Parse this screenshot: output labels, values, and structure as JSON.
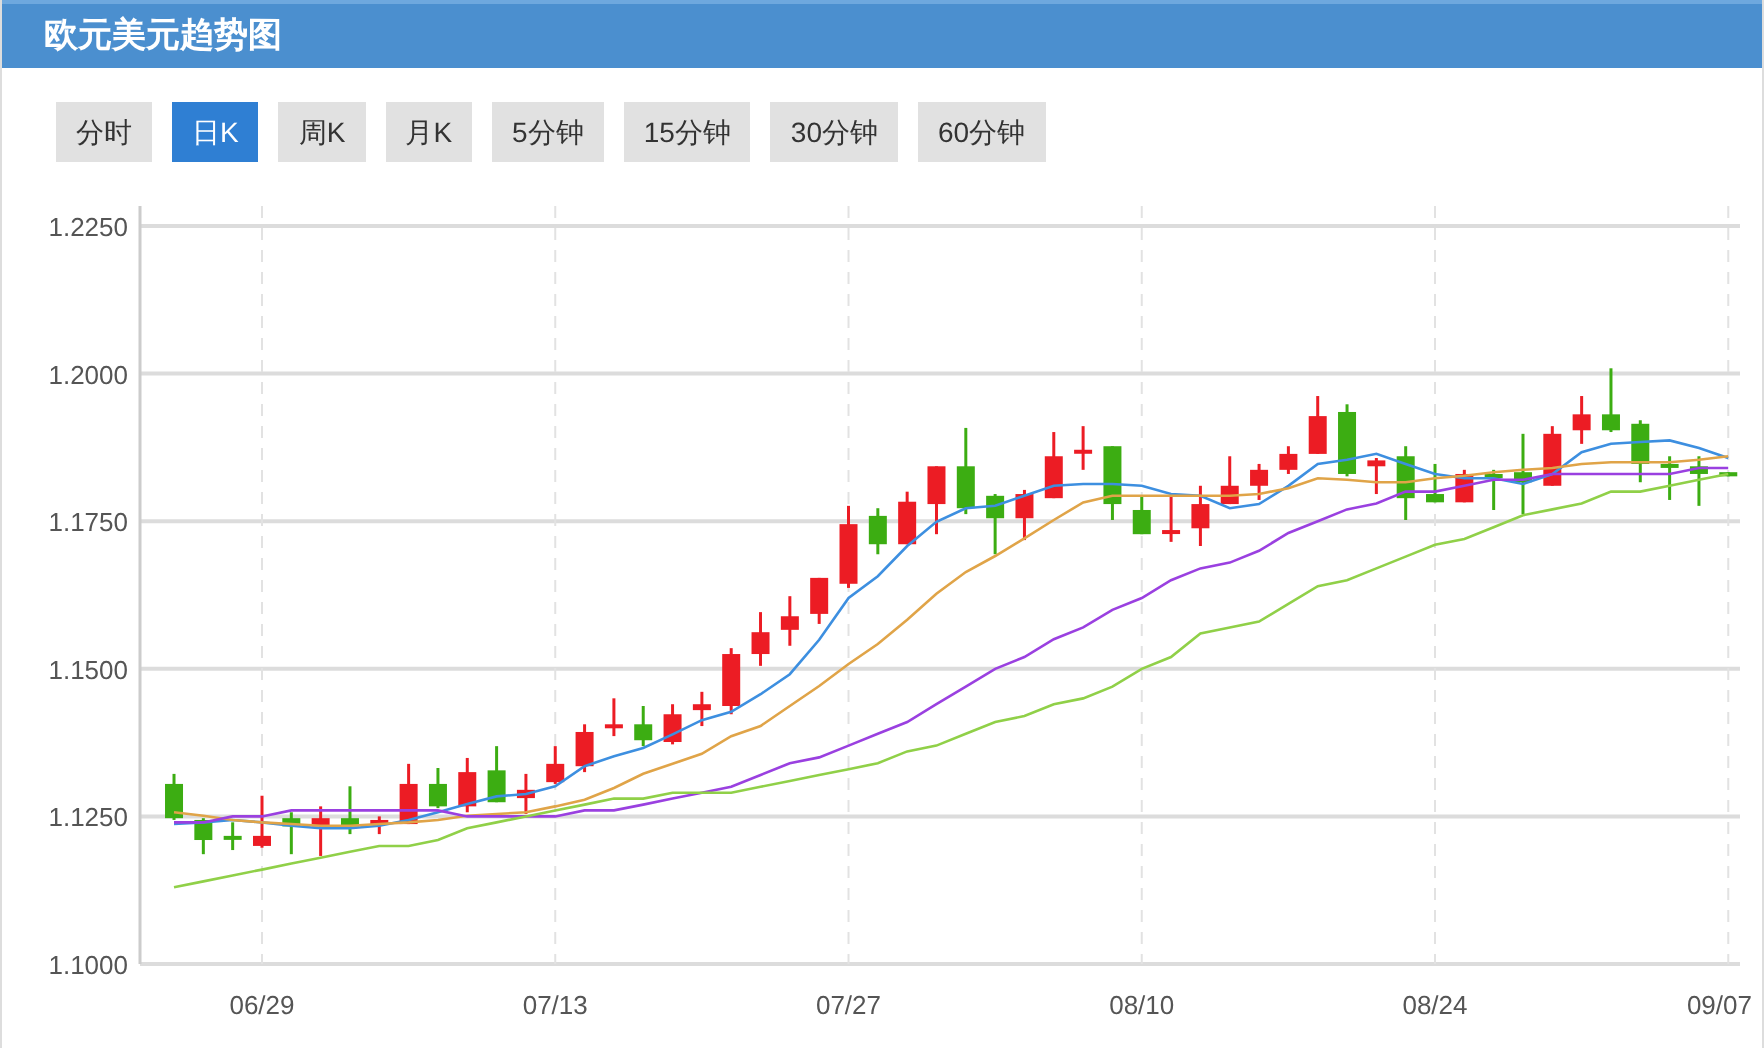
{
  "title": "欧元美元趋势图",
  "periods": [
    {
      "label": "分时",
      "selected": false
    },
    {
      "label": "日K",
      "selected": true
    },
    {
      "label": "周K",
      "selected": false
    },
    {
      "label": "月K",
      "selected": false
    },
    {
      "label": "5分钟",
      "selected": false
    },
    {
      "label": "15分钟",
      "selected": false
    },
    {
      "label": "30分钟",
      "selected": false
    },
    {
      "label": "60分钟",
      "selected": false
    }
  ],
  "chart": {
    "chart_data": {
      "type": "candlestick",
      "grid": true,
      "categories": [
        null,
        null,
        null,
        "06/29",
        null,
        null,
        null,
        null,
        null,
        null,
        null,
        null,
        null,
        "07/13",
        null,
        null,
        null,
        null,
        null,
        null,
        null,
        null,
        null,
        "07/27",
        null,
        null,
        null,
        null,
        null,
        null,
        null,
        null,
        null,
        "08/10",
        null,
        null,
        null,
        null,
        null,
        null,
        null,
        null,
        null,
        "08/24",
        null,
        null,
        null,
        null,
        null,
        null,
        null,
        null,
        null,
        "09/07"
      ],
      "ylim": [
        1.1,
        1.225
      ],
      "yticks": [
        {
          "value": 1.1,
          "label": "1.1000"
        },
        {
          "value": 1.125,
          "label": "1.1250"
        },
        {
          "value": 1.15,
          "label": "1.1500"
        },
        {
          "value": 1.175,
          "label": "1.1750"
        },
        {
          "value": 1.2,
          "label": "1.2000"
        },
        {
          "value": 1.225,
          "label": "1.2250"
        }
      ],
      "ohlc": [
        [
          1.1305,
          1.1322,
          1.1244,
          1.1247
        ],
        [
          1.1244,
          1.1247,
          1.1186,
          1.121
        ],
        [
          1.1217,
          1.124,
          1.1193,
          1.1214
        ],
        [
          1.12,
          1.1285,
          1.1197,
          1.1217
        ],
        [
          1.1247,
          1.1257,
          1.1186,
          1.1233
        ],
        [
          1.1233,
          1.1267,
          1.1183,
          1.1247
        ],
        [
          1.1247,
          1.1301,
          1.122,
          1.1233
        ],
        [
          1.1237,
          1.125,
          1.122,
          1.1244
        ],
        [
          1.1237,
          1.1339,
          1.1237,
          1.1305
        ],
        [
          1.1305,
          1.1332,
          1.1264,
          1.1267
        ],
        [
          1.1267,
          1.1349,
          1.1257,
          1.1325
        ],
        [
          1.1328,
          1.1369,
          1.1274,
          1.1274
        ],
        [
          1.1281,
          1.1322,
          1.1254,
          1.1295
        ],
        [
          1.1308,
          1.1369,
          1.1305,
          1.1339
        ],
        [
          1.1335,
          1.1406,
          1.1325,
          1.1393
        ],
        [
          1.1403,
          1.145,
          1.1386,
          1.1406
        ],
        [
          1.1406,
          1.1437,
          1.1369,
          1.1379
        ],
        [
          1.1376,
          1.144,
          1.1372,
          1.1423
        ],
        [
          1.143,
          1.1461,
          1.1403,
          1.144
        ],
        [
          1.1437,
          1.1535,
          1.1423,
          1.1525
        ],
        [
          1.1525,
          1.1596,
          1.1505,
          1.1562
        ],
        [
          1.1566,
          1.1623,
          1.1539,
          1.1589
        ],
        [
          1.1593,
          1.1654,
          1.1576,
          1.1654
        ],
        [
          1.1644,
          1.1776,
          1.1637,
          1.1745
        ],
        [
          1.1759,
          1.1772,
          1.1694,
          1.1711
        ],
        [
          1.1711,
          1.18,
          1.1711,
          1.1783
        ],
        [
          1.1779,
          1.1843,
          1.1728,
          1.1843
        ],
        [
          1.1843,
          1.1908,
          1.1762,
          1.1772
        ],
        [
          1.1793,
          1.1796,
          1.1694,
          1.1755
        ],
        [
          1.1755,
          1.1803,
          1.1718,
          1.1796
        ],
        [
          1.1789,
          1.1901,
          1.1789,
          1.186
        ],
        [
          1.1868,
          1.1911,
          1.1837,
          1.1871
        ],
        [
          1.1877,
          1.1877,
          1.1752,
          1.1779
        ],
        [
          1.1769,
          1.1793,
          1.1728,
          1.1728
        ],
        [
          1.1732,
          1.1793,
          1.1715,
          1.1735
        ],
        [
          1.1738,
          1.181,
          1.1708,
          1.1779
        ],
        [
          1.1779,
          1.186,
          1.1779,
          1.181
        ],
        [
          1.181,
          1.1847,
          1.1786,
          1.1837
        ],
        [
          1.1837,
          1.1877,
          1.183,
          1.1864
        ],
        [
          1.1864,
          1.1962,
          1.1864,
          1.1928
        ],
        [
          1.1935,
          1.1948,
          1.1826,
          1.183
        ],
        [
          1.1843,
          1.1857,
          1.1796,
          1.1853
        ],
        [
          1.186,
          1.1877,
          1.1752,
          1.1789
        ],
        [
          1.1796,
          1.1847,
          1.1782,
          1.1782
        ],
        [
          1.1782,
          1.1837,
          1.1782,
          1.183
        ],
        [
          1.183,
          1.1837,
          1.1769,
          1.1823
        ],
        [
          1.1833,
          1.1898,
          1.1762,
          1.1816
        ],
        [
          1.181,
          1.1911,
          1.181,
          1.1898
        ],
        [
          1.1904,
          1.1962,
          1.1881,
          1.1931
        ],
        [
          1.1931,
          1.2009,
          1.1901,
          1.1904
        ],
        [
          1.1915,
          1.1921,
          1.1816,
          1.1847
        ],
        [
          1.1847,
          1.186,
          1.1786,
          1.1843
        ],
        [
          1.1843,
          1.186,
          1.1776,
          1.183
        ],
        [
          1.1833,
          1.1833,
          1.1826,
          1.1826
        ]
      ],
      "series": [
        {
          "type": "line",
          "color": "#3d8fe0",
          "values": [
            1.1237,
            1.124,
            1.1244,
            1.124,
            1.1234,
            1.123,
            1.123,
            1.1234,
            1.1244,
            1.1257,
            1.1271,
            1.1284,
            1.1288,
            1.1301,
            1.1335,
            1.1352,
            1.1366,
            1.1389,
            1.1413,
            1.1427,
            1.1457,
            1.1491,
            1.1549,
            1.162,
            1.1657,
            1.1708,
            1.1749,
            1.1772,
            1.1776,
            1.1793,
            1.181,
            1.1813,
            1.1813,
            1.181,
            1.1796,
            1.1793,
            1.1772,
            1.1779,
            1.181,
            1.1847,
            1.1854,
            1.1864,
            1.1847,
            1.183,
            1.1823,
            1.1823,
            1.1813,
            1.183,
            1.1867,
            1.1881,
            1.1884,
            1.1887,
            1.1874,
            1.1857
          ]
        },
        {
          "type": "line",
          "color": "#e0a448",
          "values": [
            1.1257,
            1.1251,
            1.1244,
            1.124,
            1.1237,
            1.1234,
            1.1234,
            1.1237,
            1.124,
            1.1244,
            1.1251,
            1.1254,
            1.1257,
            1.1267,
            1.1278,
            1.1298,
            1.1322,
            1.1339,
            1.1356,
            1.1386,
            1.1403,
            1.1437,
            1.1471,
            1.1508,
            1.1542,
            1.1583,
            1.1627,
            1.1664,
            1.1691,
            1.1721,
            1.1752,
            1.1782,
            1.1793,
            1.1793,
            1.1793,
            1.1793,
            1.1793,
            1.1796,
            1.1806,
            1.1823,
            1.182,
            1.1816,
            1.1816,
            1.1823,
            1.1827,
            1.1833,
            1.1837,
            1.184,
            1.1847,
            1.185,
            1.185,
            1.185,
            1.1854,
            1.186
          ]
        },
        {
          "type": "line",
          "color": "#9a40e0",
          "values": [
            1.124,
            1.124,
            1.125,
            1.125,
            1.126,
            1.126,
            1.126,
            1.126,
            1.126,
            1.126,
            1.125,
            1.125,
            1.125,
            1.125,
            1.126,
            1.126,
            1.127,
            1.128,
            1.129,
            1.13,
            1.132,
            1.134,
            1.135,
            1.137,
            1.139,
            1.141,
            1.144,
            1.147,
            1.15,
            1.152,
            1.155,
            1.157,
            1.16,
            1.162,
            1.165,
            1.167,
            1.168,
            1.17,
            1.173,
            1.175,
            1.177,
            1.178,
            1.18,
            1.18,
            1.181,
            1.182,
            1.182,
            1.183,
            1.183,
            1.183,
            1.183,
            1.183,
            1.184,
            1.184
          ]
        },
        {
          "type": "line",
          "color": "#90d048",
          "values": [
            1.113,
            1.114,
            1.115,
            1.116,
            1.117,
            1.118,
            1.119,
            1.12,
            1.12,
            1.121,
            1.123,
            1.124,
            1.125,
            1.126,
            1.127,
            1.128,
            1.128,
            1.129,
            1.129,
            1.129,
            1.13,
            1.131,
            1.132,
            1.133,
            1.134,
            1.136,
            1.137,
            1.139,
            1.141,
            1.142,
            1.144,
            1.145,
            1.147,
            1.15,
            1.152,
            1.156,
            1.157,
            1.158,
            1.161,
            1.164,
            1.165,
            1.167,
            1.169,
            1.171,
            1.172,
            1.174,
            1.176,
            1.177,
            1.178,
            1.18,
            1.18,
            1.181,
            1.182,
            1.183
          ]
        }
      ]
    }
  }
}
